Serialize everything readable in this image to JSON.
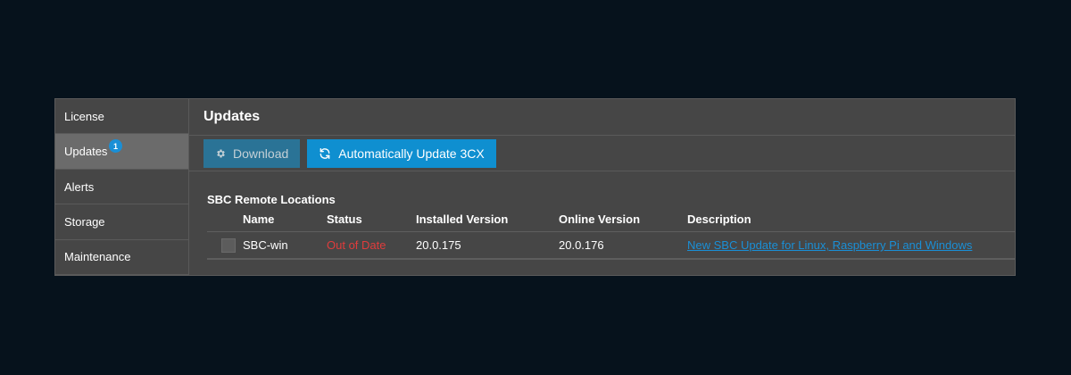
{
  "sidebar": {
    "items": [
      {
        "label": "License",
        "active": false
      },
      {
        "label": "Updates",
        "active": true,
        "badge": "1"
      },
      {
        "label": "Alerts",
        "active": false
      },
      {
        "label": "Storage",
        "active": false
      },
      {
        "label": "Maintenance",
        "active": false
      }
    ]
  },
  "header": {
    "title": "Updates"
  },
  "toolbar": {
    "download_label": "Download",
    "download_icon": "gear-icon",
    "auto_update_label": "Automatically Update 3CX",
    "auto_update_icon": "refresh-icon"
  },
  "section": {
    "title": "SBC Remote Locations",
    "columns": [
      "Name",
      "Status",
      "Installed Version",
      "Online Version",
      "Description"
    ],
    "rows": [
      {
        "name": "SBC-win",
        "status": "Out of Date",
        "installed_version": "20.0.175",
        "online_version": "20.0.176",
        "description": "New SBC Update for Linux, Raspberry Pi and Windows"
      }
    ]
  },
  "colors": {
    "background": "#06121c",
    "panel": "#464646",
    "active_item": "#6b6b6b",
    "accent": "#0f8fd0",
    "status_out_of_date": "#e03c3c"
  }
}
